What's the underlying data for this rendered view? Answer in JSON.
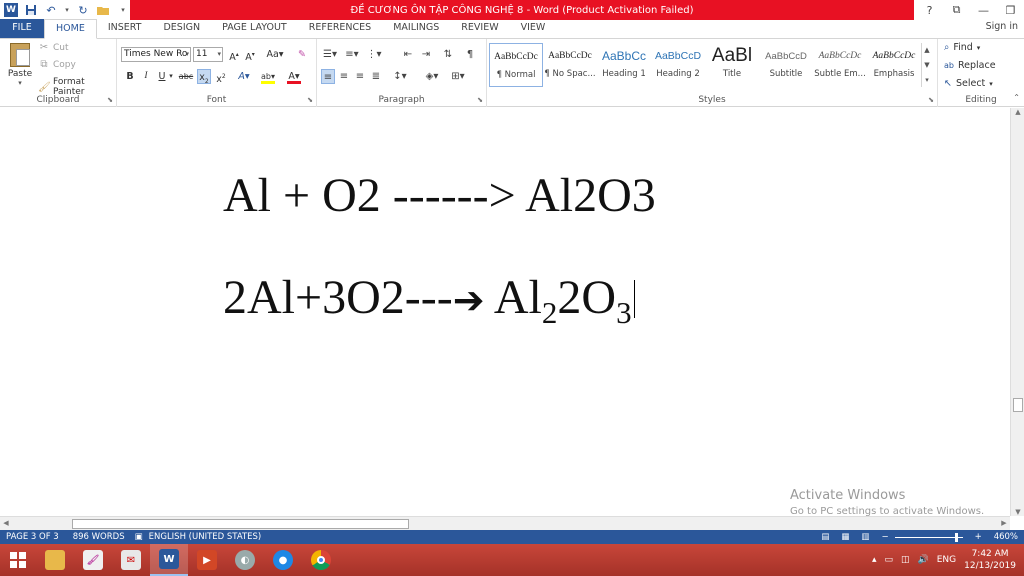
{
  "window": {
    "title": "ĐỀ CƯƠNG ÔN TẬP CÔNG NGHỆ 8 -  Word (Product Activation Failed)",
    "controls": [
      "?",
      "⧉",
      "—",
      "❐"
    ]
  },
  "tabs": [
    "FILE",
    "HOME",
    "INSERT",
    "DESIGN",
    "PAGE LAYOUT",
    "REFERENCES",
    "MAILINGS",
    "REVIEW",
    "VIEW"
  ],
  "active_tab": "HOME",
  "signin": "Sign in",
  "clipboard": {
    "paste": "Paste",
    "cut": "Cut",
    "copy": "Copy",
    "format_painter": "Format Painter",
    "label": "Clipboard"
  },
  "font": {
    "name": "Times New Ro",
    "size": "11",
    "label": "Font"
  },
  "paragraph": {
    "label": "Paragraph"
  },
  "styles": {
    "label": "Styles",
    "items": [
      {
        "preview": "AaBbCcDc",
        "name": "¶ Normal"
      },
      {
        "preview": "AaBbCcDc",
        "name": "¶ No Spac..."
      },
      {
        "preview": "AaBbCc",
        "name": "Heading 1"
      },
      {
        "preview": "AaBbCcD",
        "name": "Heading 2"
      },
      {
        "preview": "AaBl",
        "name": "Title"
      },
      {
        "preview": "AaBbCcD",
        "name": "Subtitle"
      },
      {
        "preview": "AaBbCcDc",
        "name": "Subtle Em..."
      },
      {
        "preview": "AaBbCcDc",
        "name": "Emphasis"
      }
    ]
  },
  "editing": {
    "find": "Find",
    "replace": "Replace",
    "select": "Select",
    "label": "Editing"
  },
  "document": {
    "line1": "Al + O2 ------> Al2O3",
    "line2_prefix": "2Al+3O2---",
    "line2_arrow": "➔",
    "line2_al": "Al",
    "line2_sub1": "2",
    "line2_o": "2O",
    "line2_sub2": "3"
  },
  "activation": {
    "title": "Activate Windows",
    "subtitle": "Go to PC settings to activate Windows."
  },
  "statusbar": {
    "page": "PAGE 3 OF 3",
    "words": "896 WORDS",
    "language": "ENGLISH (UNITED STATES)",
    "zoom": "460%"
  },
  "taskbar": {
    "lang": "ENG",
    "time": "7:42 AM",
    "date": "12/13/2019"
  },
  "colors": {
    "word_blue": "#2b579a",
    "title_red": "#e81123",
    "taskbar_red": "#b93a2f"
  }
}
